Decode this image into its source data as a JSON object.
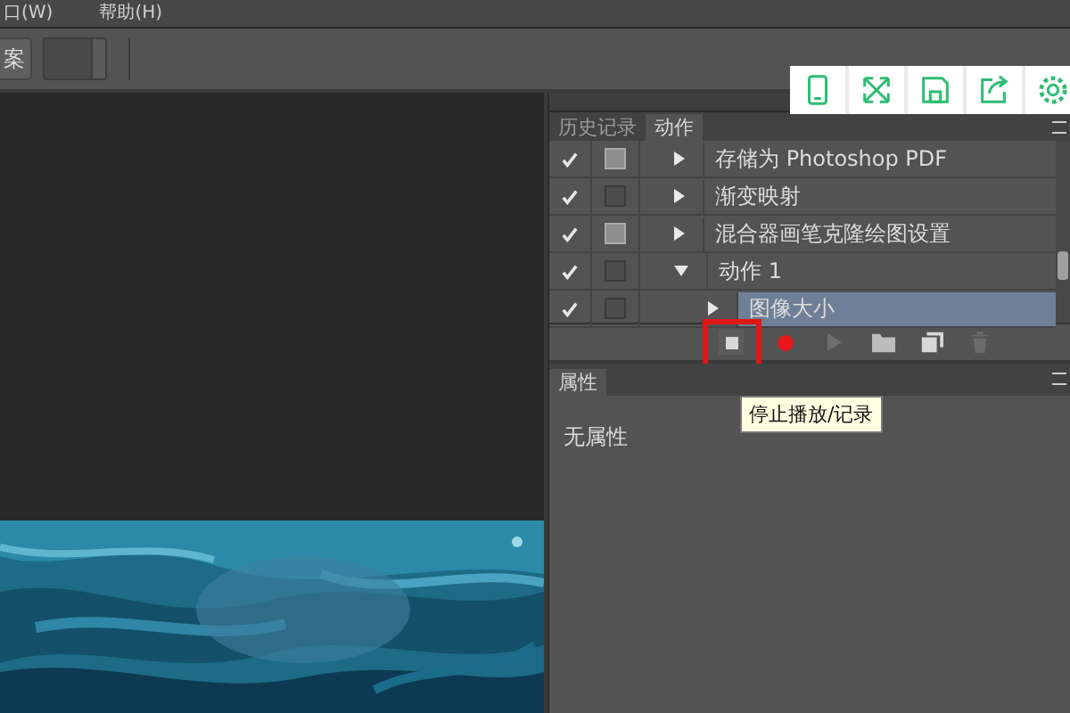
{
  "menu": [
    "口(W)",
    "帮助(H)"
  ],
  "options_bar": {
    "button": "案"
  },
  "panel_tabs": [
    {
      "label": "历史记录",
      "selected": false
    },
    {
      "label": "动作",
      "selected": true
    }
  ],
  "actions": [
    {
      "label": "存储为 Photoshop PDF",
      "checked": true,
      "dialog": true,
      "expanded": false,
      "selected": false
    },
    {
      "label": "渐变映射",
      "checked": true,
      "dialog": false,
      "expanded": false,
      "selected": false
    },
    {
      "label": "混合器画笔克隆绘图设置",
      "checked": true,
      "dialog": true,
      "expanded": false,
      "selected": false
    },
    {
      "label": "动作 1",
      "checked": true,
      "dialog": false,
      "expanded": true,
      "selected": false,
      "children": [
        {
          "label": "图像大小",
          "checked": true,
          "dialog": false,
          "expanded": false,
          "selected": true
        }
      ]
    }
  ],
  "action_toolbar": {
    "stop_highlighted": true
  },
  "tooltip": "停止播放/记录",
  "properties": {
    "tab": "属性",
    "text": "无属性"
  }
}
